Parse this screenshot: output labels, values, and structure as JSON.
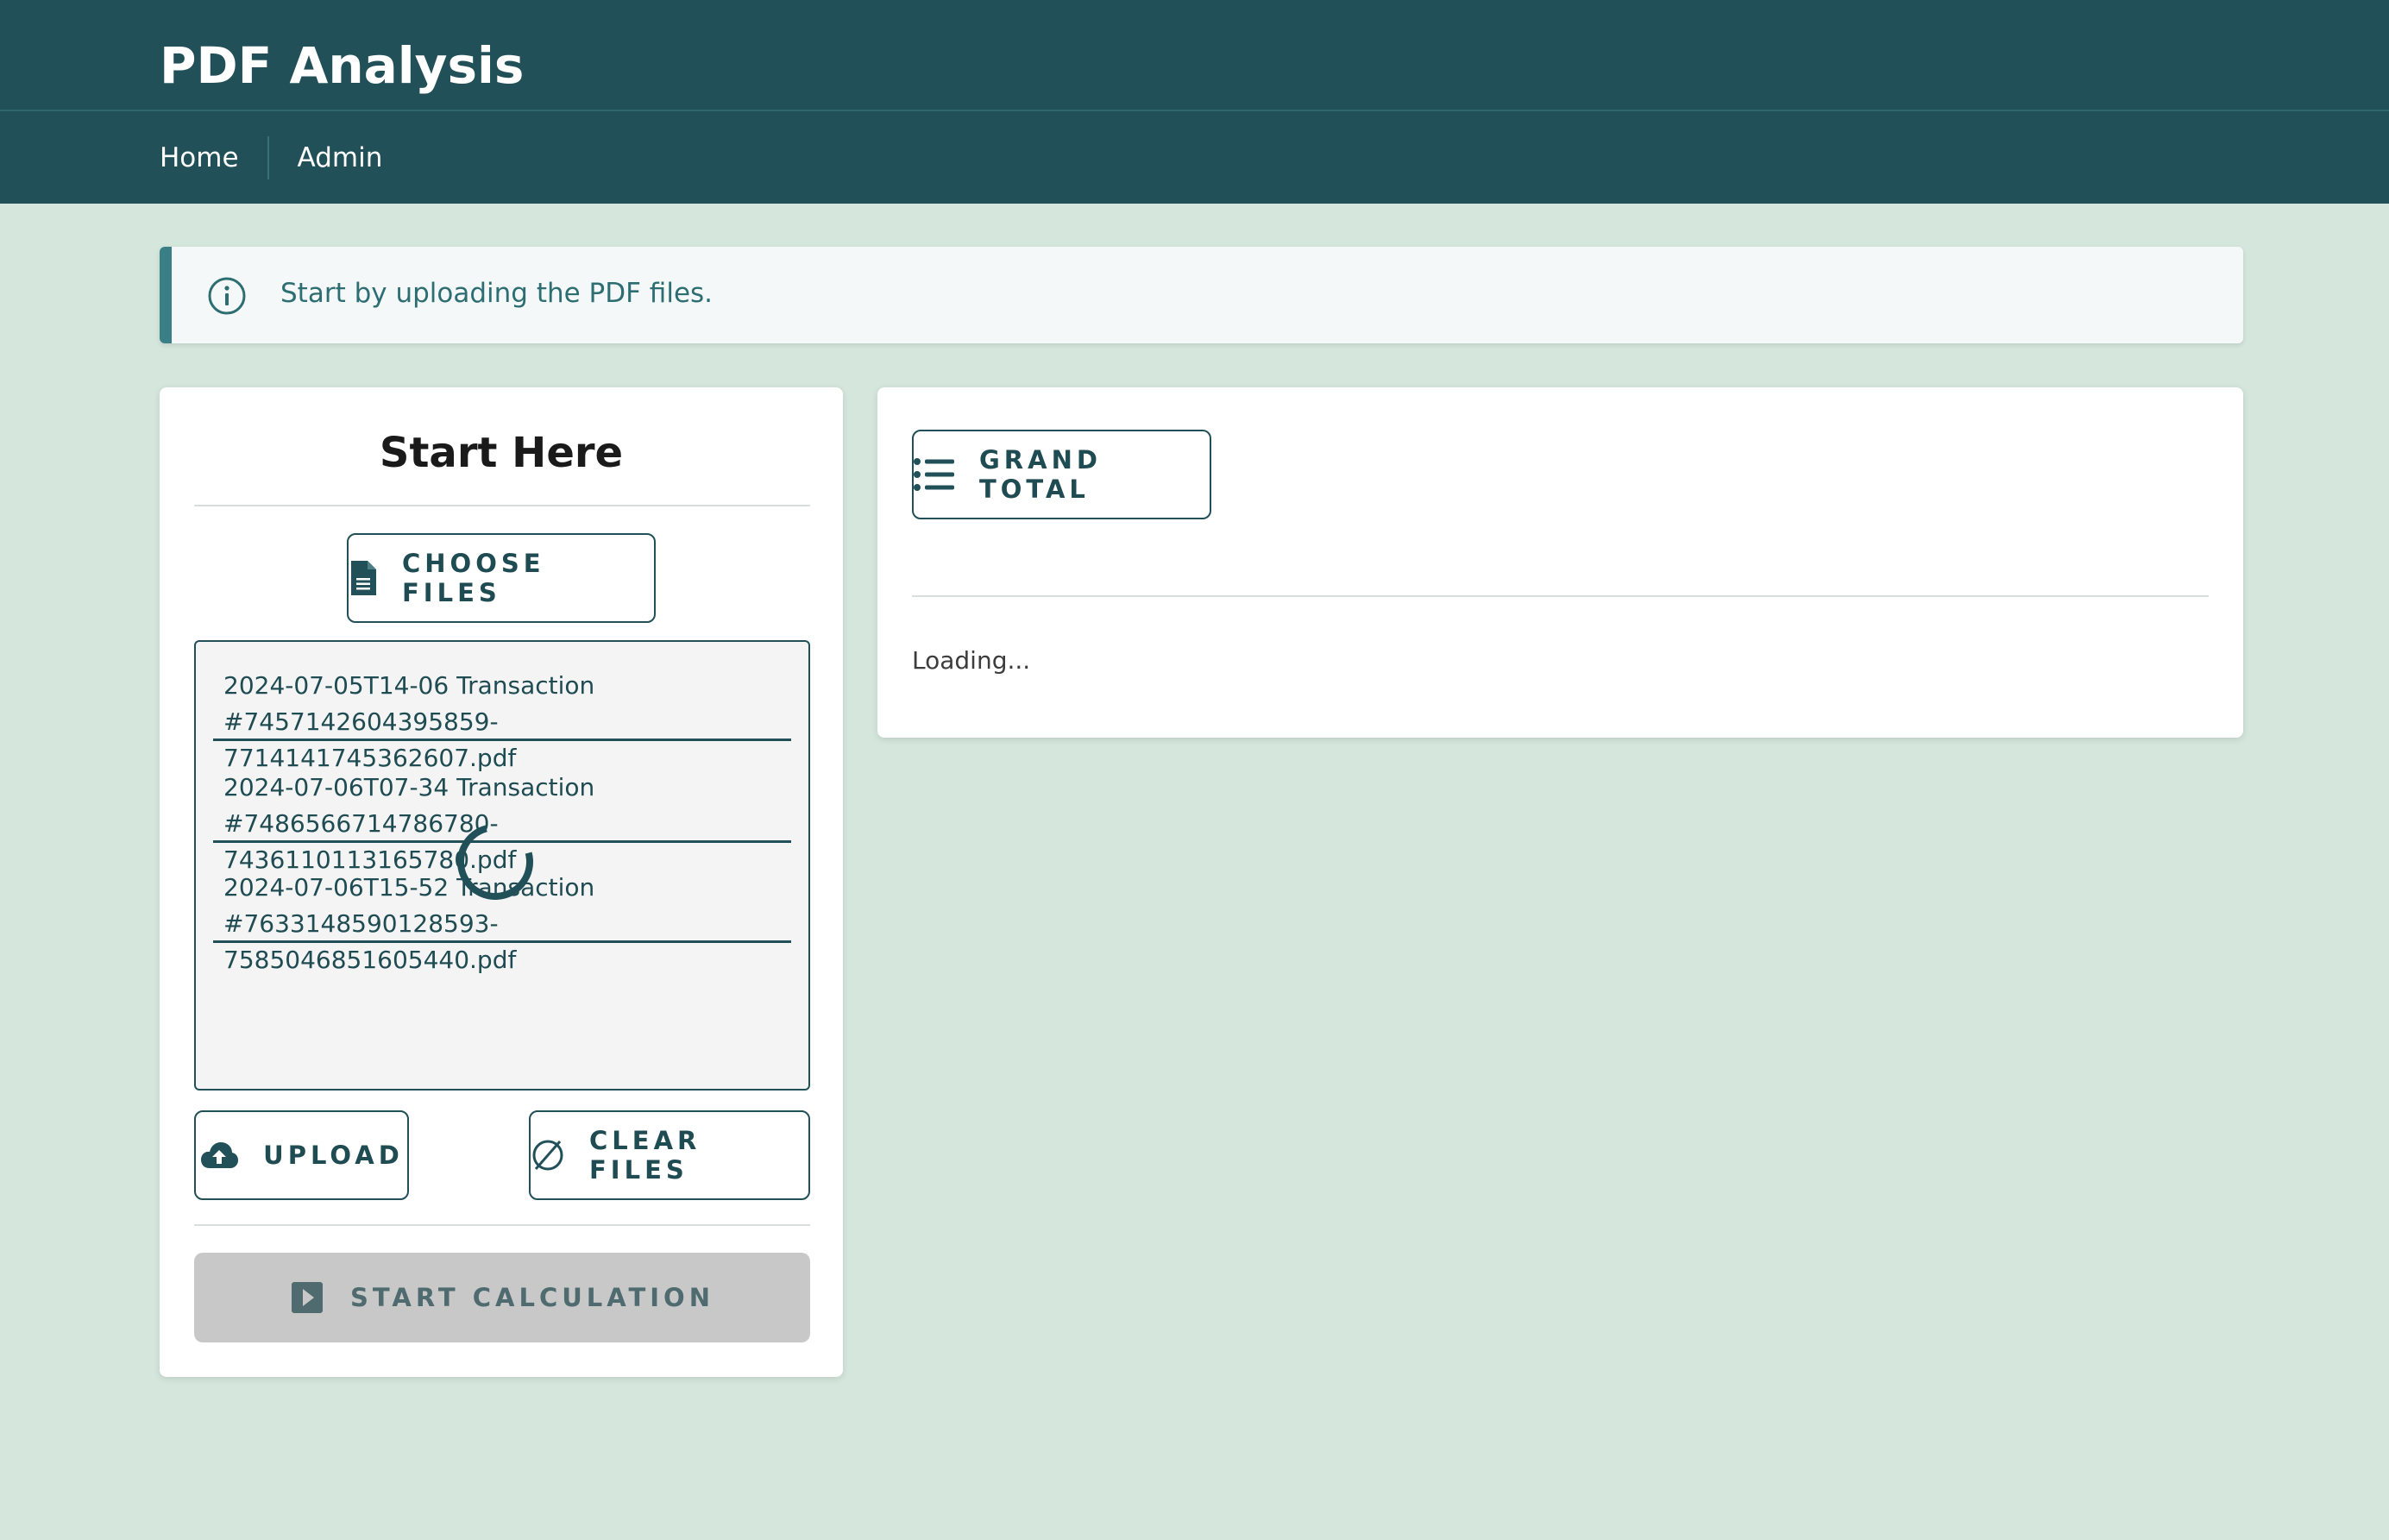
{
  "header": {
    "title": "PDF Analysis"
  },
  "nav": {
    "items": [
      {
        "label": "Home"
      },
      {
        "label": "Admin"
      }
    ]
  },
  "info": {
    "message": "Start by uploading the PDF files.",
    "icon": "info-circle-icon"
  },
  "start_panel": {
    "title": "Start Here",
    "choose_files_label": "CHOOSE FILES",
    "files": [
      {
        "line1": "2024-07-05T14-06 Transaction",
        "line2": "#7457142604395859-7714141745362607.pdf"
      },
      {
        "line1": "2024-07-06T07-34 Transaction",
        "line2": "#7486566714786780-7436110113165780.pdf"
      },
      {
        "line1": "2024-07-06T15-52 Transaction",
        "line2": "#7633148590128593-7585046851605440.pdf"
      }
    ],
    "upload_label": "UPLOAD",
    "clear_files_label": "CLEAR FILES",
    "start_calculation_label": "START CALCULATION"
  },
  "results_panel": {
    "grand_total_label": "GRAND TOTAL",
    "status_text": "Loading..."
  },
  "colors": {
    "header_bg": "#215059",
    "page_bg": "#d5e7dd",
    "accent": "#3b7f86"
  }
}
